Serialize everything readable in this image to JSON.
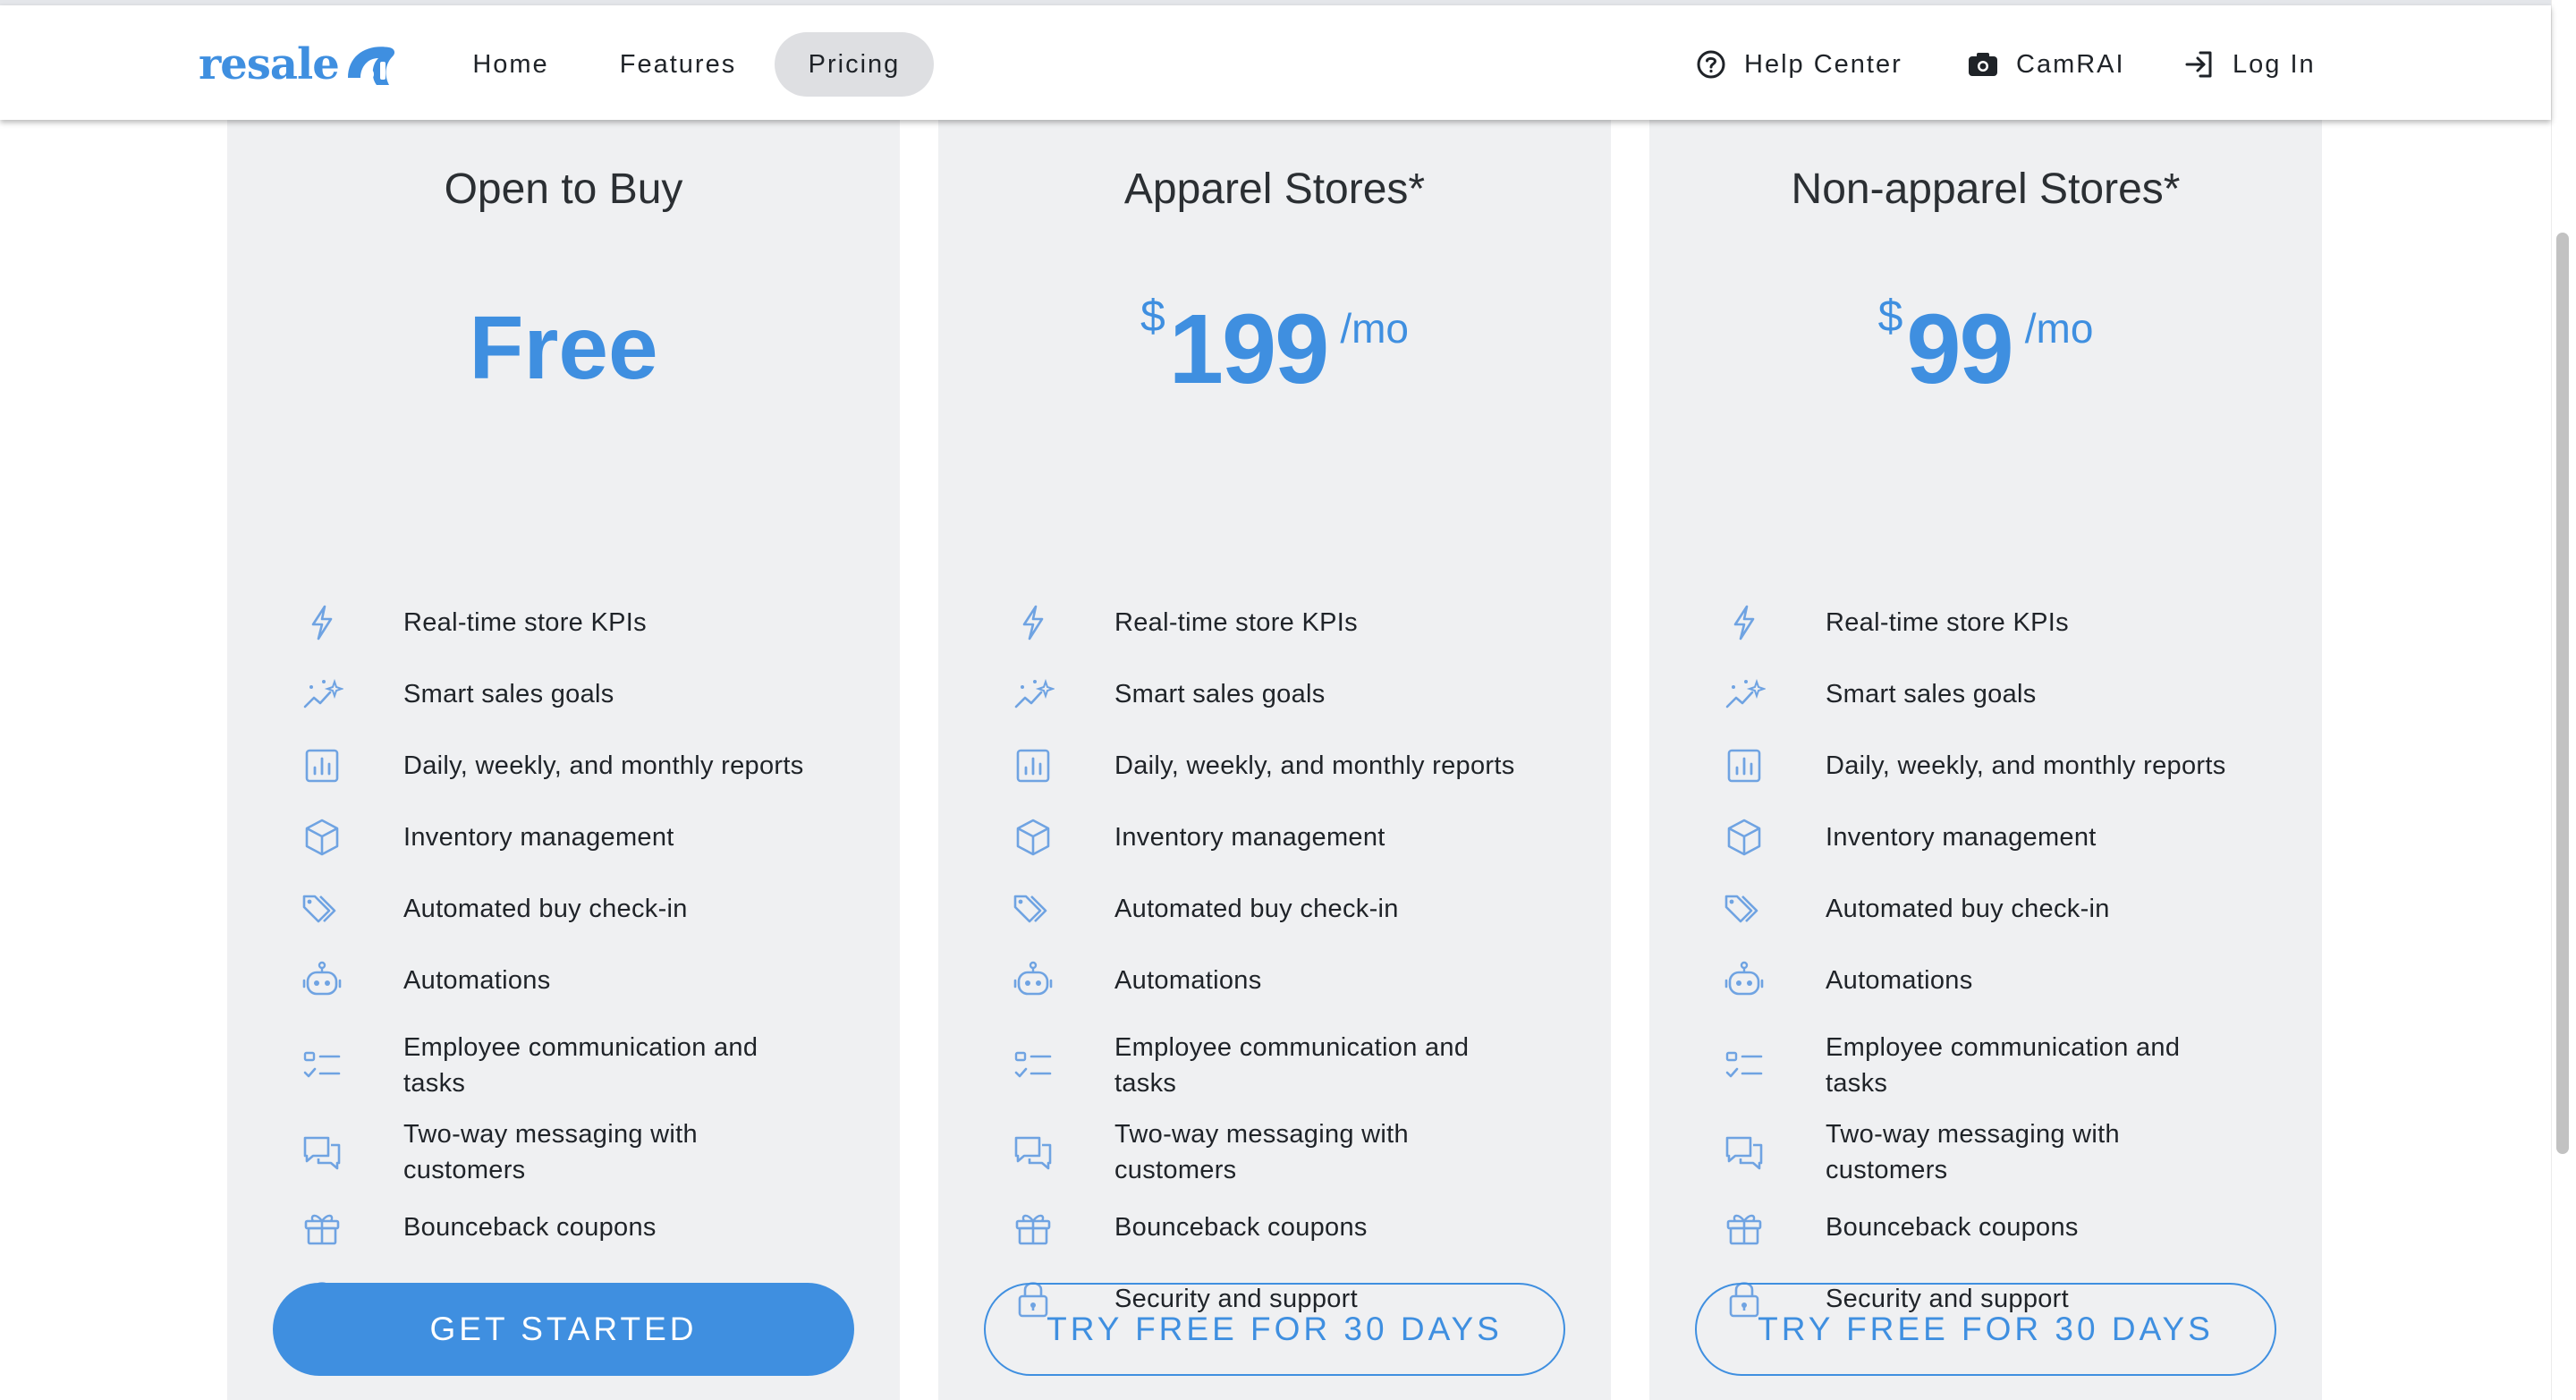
{
  "colors": {
    "accent": "#3f8fe0",
    "card_bg": "#eff0f2",
    "active_pill": "#dedfe2",
    "text": "#1f2328"
  },
  "brand": {
    "logo_text": "resale",
    "logo_mark": "ai"
  },
  "nav": {
    "home": "Home",
    "features": "Features",
    "pricing": "Pricing",
    "active": "Pricing"
  },
  "utility": {
    "help": {
      "label": "Help Center",
      "icon": "help-circle-icon"
    },
    "camrai": {
      "label": "CamRAI",
      "icon": "camera-icon"
    },
    "login": {
      "label": "Log In",
      "icon": "login-icon"
    }
  },
  "features": [
    {
      "label": "Real-time store KPIs",
      "icon": "bolt-icon"
    },
    {
      "label": "Smart sales goals",
      "icon": "sparkle-trend-icon"
    },
    {
      "label": "Daily, weekly, and monthly reports",
      "icon": "bar-chart-icon"
    },
    {
      "label": "Inventory management",
      "icon": "box-icon"
    },
    {
      "label": "Automated buy check-in",
      "icon": "tags-icon"
    },
    {
      "label": "Automations",
      "icon": "robot-icon"
    },
    {
      "label": "Employee communication and tasks",
      "icon": "checklist-icon"
    },
    {
      "label": "Two-way messaging with customers",
      "icon": "chat-icon"
    },
    {
      "label": "Bounceback coupons",
      "icon": "gift-icon"
    },
    {
      "label": "Security and support",
      "icon": "lock-icon"
    }
  ],
  "plans": [
    {
      "title": "Open to Buy",
      "price_text": "Free",
      "cta": "GET STARTED"
    },
    {
      "title": "Apparel Stores*",
      "currency": "$",
      "amount": "199",
      "period": "/mo",
      "cta": "TRY FREE FOR 30 DAYS"
    },
    {
      "title": "Non-apparel Stores*",
      "currency": "$",
      "amount": "99",
      "period": "/mo",
      "cta": "TRY FREE FOR 30 DAYS"
    }
  ]
}
